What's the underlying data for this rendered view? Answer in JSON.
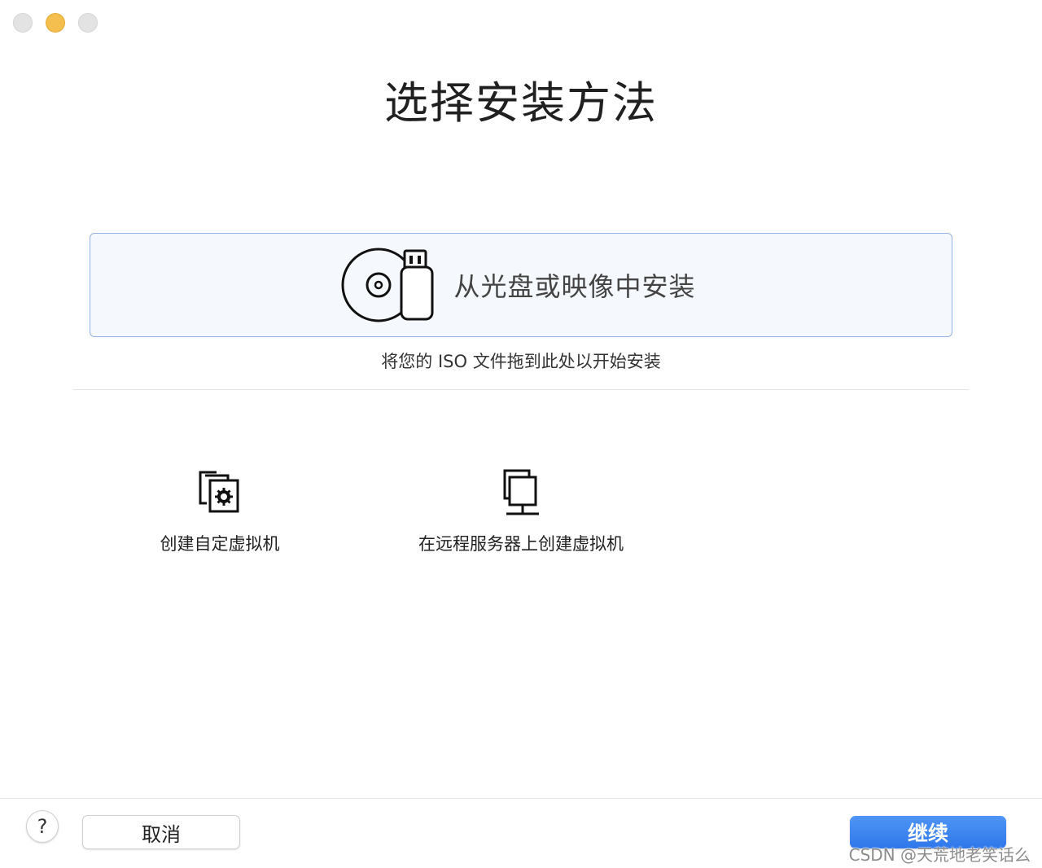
{
  "window": {
    "controls": [
      "close",
      "minimize",
      "zoom"
    ]
  },
  "header": {
    "title": "选择安装方法"
  },
  "drop_zone": {
    "label": "从光盘或映像中安装",
    "icon": "disc-usb-icon",
    "hint": "将您的 ISO 文件拖到此处以开始安装"
  },
  "options": [
    {
      "label": "创建自定虚拟机",
      "icon": "custom-vm-icon"
    },
    {
      "label": "在远程服务器上创建虚拟机",
      "icon": "remote-server-icon"
    }
  ],
  "footer": {
    "help_label": "?",
    "cancel_label": "取消",
    "continue_label": "继续"
  },
  "watermark": "CSDN @天荒地老笑话么",
  "colors": {
    "accent": "#3b82f0",
    "drop_zone_bg": "#f5f8fd",
    "drop_zone_border": "#94b3e6",
    "minimize": "#f4bf4f"
  }
}
